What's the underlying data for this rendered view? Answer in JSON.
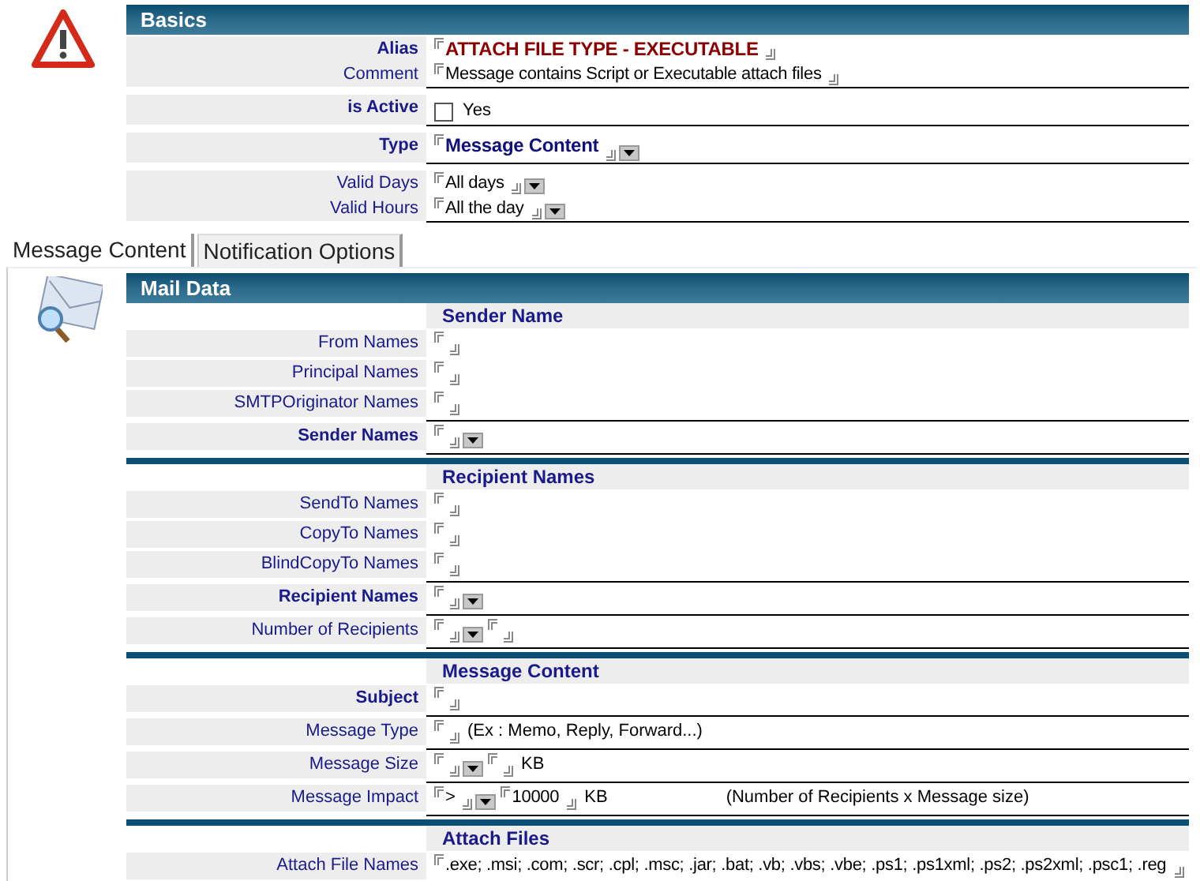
{
  "basics": {
    "title": "Basics",
    "groups": [
      {
        "rows": [
          {
            "label": "Alias",
            "bold": true,
            "fields": [
              {
                "kind": "input",
                "value": "ATTACH FILE TYPE - EXECUTABLE",
                "bold": true,
                "color": "#8b0000"
              }
            ]
          },
          {
            "label": "Comment",
            "bold": false,
            "fields": [
              {
                "kind": "input",
                "value": "Message contains Script or Executable attach files"
              }
            ]
          }
        ]
      },
      {
        "rows": [
          {
            "label": "is Active",
            "bold": true,
            "fields": [
              {
                "kind": "checkbox",
                "label": "Yes",
                "checked": false
              }
            ]
          }
        ]
      },
      {
        "rows": [
          {
            "label": "Type",
            "bold": true,
            "fields": [
              {
                "kind": "input",
                "value": "Message Content",
                "bold": true,
                "color": "#10107a"
              },
              {
                "kind": "select"
              }
            ]
          }
        ]
      },
      {
        "rows": [
          {
            "label": "Valid Days",
            "bold": false,
            "fields": [
              {
                "kind": "input",
                "value": "All days"
              },
              {
                "kind": "select"
              }
            ]
          },
          {
            "label": "Valid Hours",
            "bold": false,
            "fields": [
              {
                "kind": "input",
                "value": "All the day"
              },
              {
                "kind": "select"
              }
            ]
          }
        ]
      }
    ]
  },
  "tabs": [
    {
      "label": "Message Content",
      "selected": true
    },
    {
      "label": "Notification Options",
      "selected": false
    }
  ],
  "mail_data": {
    "title": "Mail Data",
    "sections": [
      {
        "title": "Sender Name",
        "groups": [
          {
            "rows": [
              {
                "label": "From Names",
                "bold": false,
                "fields": [
                  {
                    "kind": "input"
                  }
                ]
              },
              {
                "label": "Principal Names",
                "bold": false,
                "fields": [
                  {
                    "kind": "input"
                  }
                ]
              },
              {
                "label": "SMTPOriginator Names",
                "bold": false,
                "fields": [
                  {
                    "kind": "input"
                  }
                ]
              }
            ]
          },
          {
            "rows": [
              {
                "label": "Sender Names",
                "bold": true,
                "fields": [
                  {
                    "kind": "input"
                  },
                  {
                    "kind": "select"
                  }
                ]
              }
            ]
          }
        ]
      },
      {
        "title": "Recipient Names",
        "groups": [
          {
            "rows": [
              {
                "label": "SendTo Names",
                "bold": false,
                "fields": [
                  {
                    "kind": "input"
                  }
                ]
              },
              {
                "label": "CopyTo Names",
                "bold": false,
                "fields": [
                  {
                    "kind": "input"
                  }
                ]
              },
              {
                "label": "BlindCopyTo Names",
                "bold": false,
                "fields": [
                  {
                    "kind": "input"
                  }
                ]
              }
            ]
          },
          {
            "rows": [
              {
                "label": "Recipient Names",
                "bold": true,
                "fields": [
                  {
                    "kind": "input"
                  },
                  {
                    "kind": "select"
                  }
                ]
              }
            ]
          },
          {
            "rows": [
              {
                "label": "Number of Recipients",
                "bold": false,
                "fields": [
                  {
                    "kind": "input"
                  },
                  {
                    "kind": "select"
                  },
                  {
                    "kind": "input"
                  }
                ]
              }
            ]
          }
        ]
      },
      {
        "title": "Message Content",
        "groups": [
          {
            "rows": [
              {
                "label": "Subject",
                "bold": true,
                "fields": [
                  {
                    "kind": "input"
                  }
                ]
              }
            ]
          },
          {
            "rows": [
              {
                "label": "Message Type",
                "bold": false,
                "fields": [
                  {
                    "kind": "input"
                  },
                  {
                    "kind": "text",
                    "text": "(Ex : Memo, Reply, Forward...)"
                  }
                ]
              }
            ]
          },
          {
            "rows": [
              {
                "label": "Message Size",
                "bold": false,
                "fields": [
                  {
                    "kind": "input"
                  },
                  {
                    "kind": "select"
                  },
                  {
                    "kind": "input"
                  },
                  {
                    "kind": "text",
                    "text": "KB"
                  }
                ]
              }
            ]
          },
          {
            "rows": [
              {
                "label": "Message Impact",
                "bold": false,
                "fields": [
                  {
                    "kind": "input",
                    "value": ">"
                  },
                  {
                    "kind": "select"
                  },
                  {
                    "kind": "input",
                    "value": "10000"
                  },
                  {
                    "kind": "text",
                    "text": "KB"
                  },
                  {
                    "kind": "note",
                    "text": "(Number of Recipients x Message size)"
                  }
                ]
              }
            ]
          }
        ]
      },
      {
        "title": "Attach Files",
        "groups": [
          {
            "rows": [
              {
                "label": "Attach File Names",
                "bold": false,
                "fields": [
                  {
                    "kind": "input",
                    "value": ".exe; .msi; .com; .scr; .cpl; .msc; .jar; .bat; .vb; .vbs; .vbe; .ps1; .ps1xml; .ps2; .ps2xml; .psc1; .reg"
                  }
                ]
              }
            ]
          }
        ]
      }
    ]
  }
}
